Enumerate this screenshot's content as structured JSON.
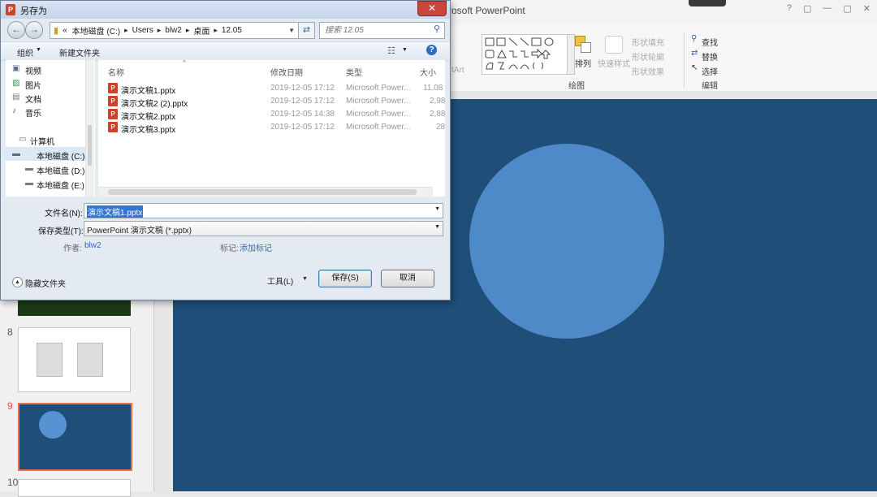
{
  "ppt": {
    "title": "rosoft PowerPoint",
    "window_controls": [
      "?",
      "▢",
      "—",
      "▢",
      "✕"
    ],
    "ribbon": {
      "shape_fill": "形状填充",
      "shape_outline": "形状轮廓",
      "shape_effects": "形状效果",
      "arrange": "排列",
      "quick_styles": "快速样式",
      "drawing_group": "绘图",
      "find": "查找",
      "replace": "替换",
      "select": "选择",
      "editing_group": "编辑",
      "smartart_fragment": "tArt"
    },
    "slides": [
      {
        "number": "8"
      },
      {
        "number": "9"
      },
      {
        "number": "10"
      }
    ],
    "accent_color": "#1f4e79",
    "selection_color": "#e8734a"
  },
  "dialog": {
    "title": "另存为",
    "close_label": "✕",
    "address_parts": [
      "«",
      "本地磁盘 (C:)",
      "Users",
      "blw2",
      "桌面",
      "12.05"
    ],
    "search_placeholder": "搜索 12.05",
    "toolbar": {
      "organize": "组织",
      "new_folder": "新建文件夹"
    },
    "nav": {
      "libraries": [
        {
          "label": "视频",
          "icon": "video-icon"
        },
        {
          "label": "图片",
          "icon": "picture-icon"
        },
        {
          "label": "文档",
          "icon": "document-icon"
        },
        {
          "label": "音乐",
          "icon": "music-icon"
        }
      ],
      "computer": "计算机",
      "drives": [
        {
          "label": "本地磁盘 (C:)",
          "icon": "drive-icon"
        },
        {
          "label": "本地磁盘 (D:)",
          "icon": "drive-icon"
        },
        {
          "label": "本地磁盘 (E:)",
          "icon": "drive-icon"
        }
      ]
    },
    "columns": {
      "name": "名称",
      "date": "修改日期",
      "type": "类型",
      "size": "大小"
    },
    "files": [
      {
        "name": "演示文稿1.pptx",
        "date": "2019-12-05 17:12",
        "type": "Microsoft Power...",
        "size": "11,08"
      },
      {
        "name": "演示文稿2 (2).pptx",
        "date": "2019-12-05 17:12",
        "type": "Microsoft Power...",
        "size": "2,98"
      },
      {
        "name": "演示文稿2.pptx",
        "date": "2019-12-05 14:38",
        "type": "Microsoft Power...",
        "size": "2,88"
      },
      {
        "name": "演示文稿3.pptx",
        "date": "2019-12-05 17:12",
        "type": "Microsoft Power...",
        "size": "28"
      }
    ],
    "form": {
      "filename_label": "文件名(N):",
      "filename_value": "演示文稿1.pptx",
      "filetype_label": "保存类型(T):",
      "filetype_value": "PowerPoint 演示文稿 (*.pptx)",
      "author_label": "作者:",
      "author_value": "blw2",
      "tags_label": "标记:",
      "tags_value": "添加标记"
    },
    "footer": {
      "hide_folders": "隐藏文件夹",
      "tools": "工具(L)",
      "save": "保存(S)",
      "cancel": "取消"
    }
  }
}
